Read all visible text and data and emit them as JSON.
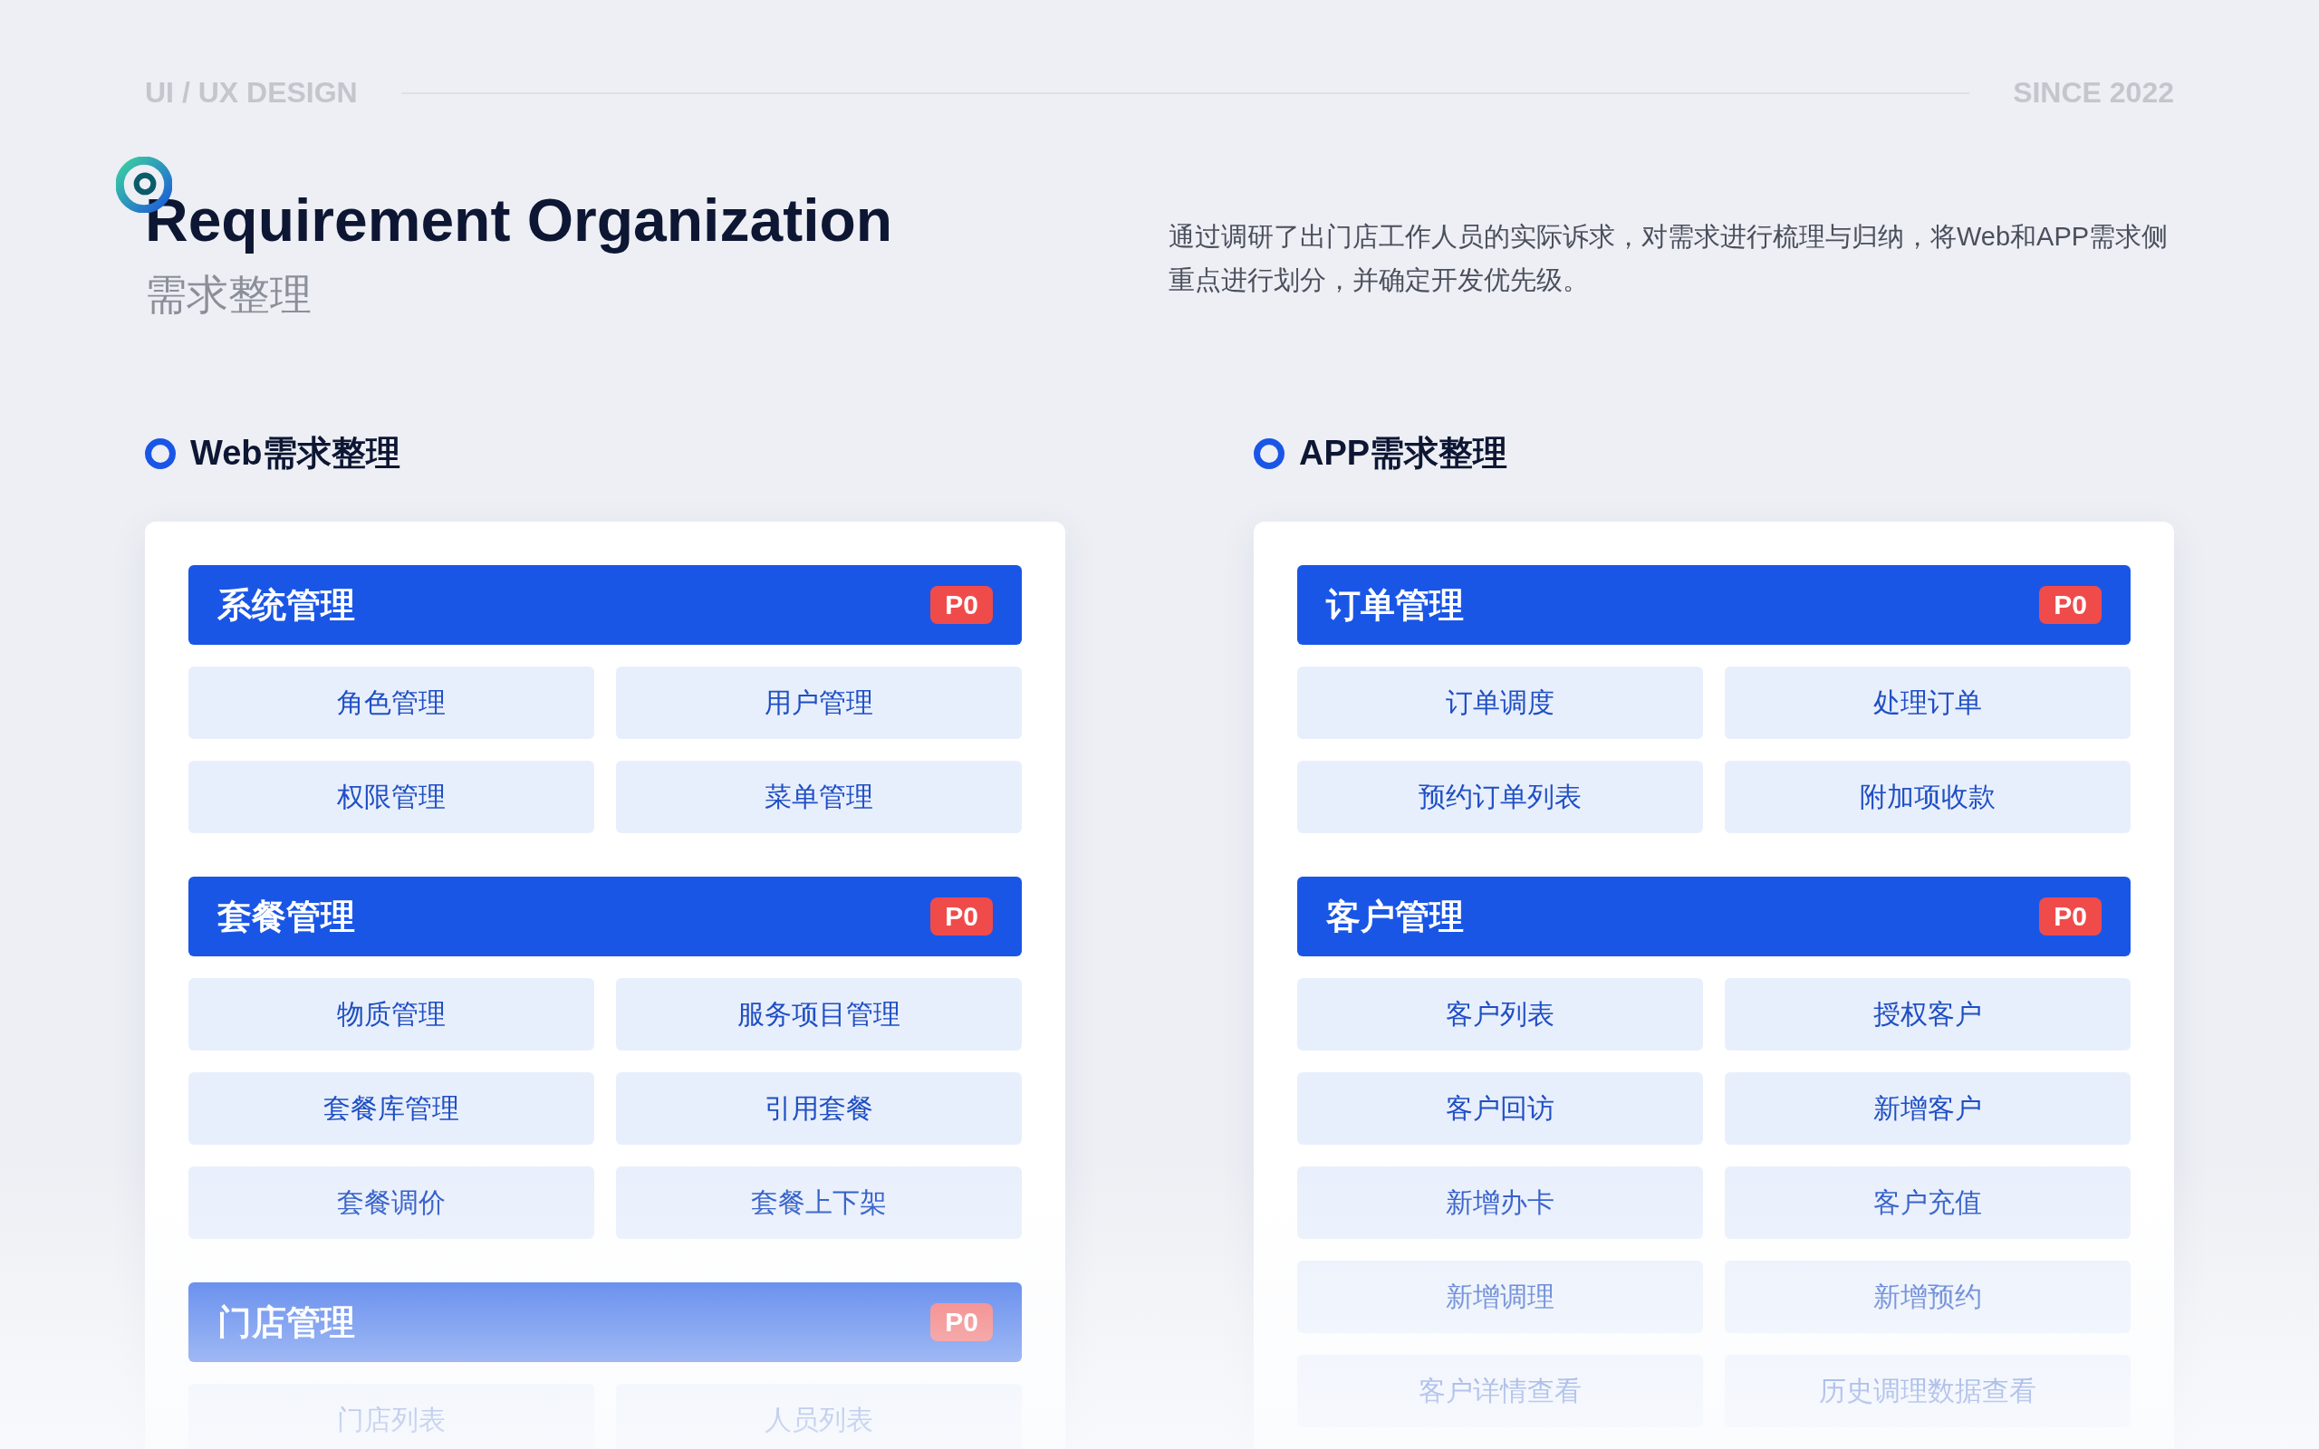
{
  "header": {
    "tag": "UI / UX DESIGN",
    "since": "SINCE 2022"
  },
  "title": {
    "en": "Requirement Organization",
    "zh": "需求整理",
    "description": "通过调研了出门店工作人员的实际诉求，对需求进行梳理与归纳，将Web和APP需求侧重点进行划分，并确定开发优先级。"
  },
  "sections": [
    {
      "heading": "Web需求整理",
      "groups": [
        {
          "title": "系统管理",
          "badge": "P0",
          "items": [
            "角色管理",
            "用户管理",
            "权限管理",
            "菜单管理"
          ]
        },
        {
          "title": "套餐管理",
          "badge": "P0",
          "items": [
            "物质管理",
            "服务项目管理",
            "套餐库管理",
            "引用套餐",
            "套餐调价",
            "套餐上下架"
          ]
        },
        {
          "title": "门店管理",
          "badge": "P0",
          "items": [
            "门店列表",
            "人员列表"
          ]
        }
      ]
    },
    {
      "heading": "APP需求整理",
      "groups": [
        {
          "title": "订单管理",
          "badge": "P0",
          "items": [
            "订单调度",
            "处理订单",
            "预约订单列表",
            "附加项收款"
          ]
        },
        {
          "title": "客户管理",
          "badge": "P0",
          "items": [
            "客户列表",
            "授权客户",
            "客户回访",
            "新增客户",
            "新增办卡",
            "客户充值",
            "新增调理",
            "新增预约",
            "客户详情查看",
            "历史调理数据查看"
          ]
        }
      ]
    }
  ]
}
